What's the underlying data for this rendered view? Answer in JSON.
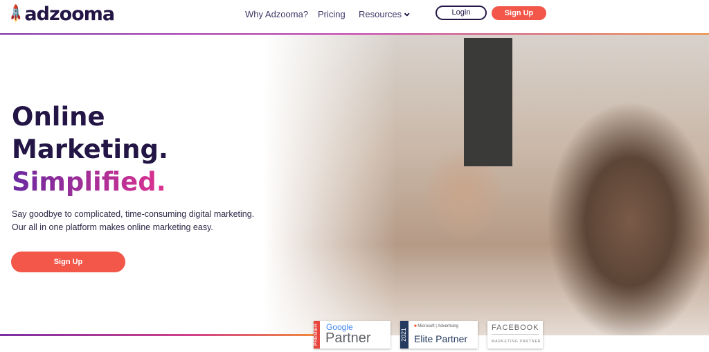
{
  "header": {
    "logo": "adzooma",
    "nav": [
      "Why Adzooma?",
      "Pricing",
      "Resources"
    ],
    "login": "Login",
    "signup": "Sign Up"
  },
  "hero": {
    "line1": "Online",
    "line2": "Marketing.",
    "line3": "Simplified.",
    "sub1": "Say goodbye to complicated, time-consuming digital marketing.",
    "sub2": "Our all in one platform makes online marketing easy.",
    "cta": "Sign Up"
  },
  "badges": {
    "google": {
      "premier": "PREMIER",
      "brand": "Google",
      "title": "Partner"
    },
    "microsoft": {
      "year": "2021",
      "brand": "Microsoft",
      "advertising": "Advertising",
      "title": "Elite Partner"
    },
    "facebook": {
      "brand": "FACEBOOK",
      "title": "MARKETING PARTNER"
    }
  },
  "colors": {
    "brand": "#231545",
    "accent": "#f2574a"
  }
}
